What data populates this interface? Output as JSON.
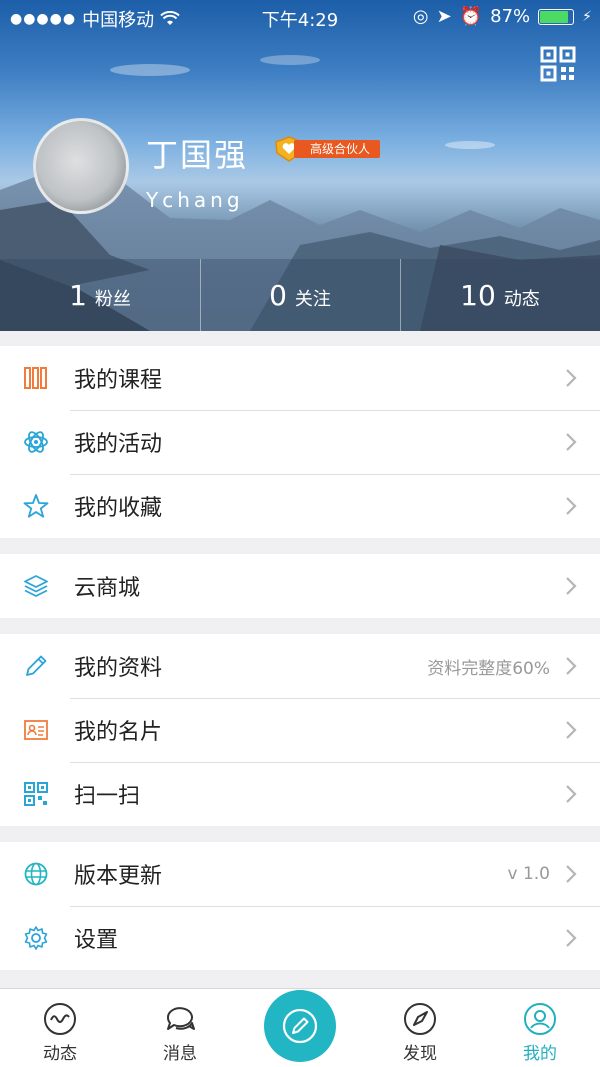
{
  "status_bar": {
    "carrier": "中国移动",
    "time": "下午4:29",
    "battery": "87%",
    "battery_level": 0.87
  },
  "profile": {
    "name": "丁国强",
    "username": "Ychang",
    "badge": "高级合伙人",
    "stats": [
      {
        "value": "1",
        "label": "粉丝"
      },
      {
        "value": "0",
        "label": "关注"
      },
      {
        "value": "10",
        "label": "动态"
      }
    ]
  },
  "menu": {
    "groups": [
      [
        {
          "id": "courses",
          "label": "我的课程",
          "icon": "books-icon"
        },
        {
          "id": "activities",
          "label": "我的活动",
          "icon": "atom-icon"
        },
        {
          "id": "favorites",
          "label": "我的收藏",
          "icon": "star-icon"
        }
      ],
      [
        {
          "id": "mall",
          "label": "云商城",
          "icon": "layers-icon"
        }
      ],
      [
        {
          "id": "profile",
          "label": "我的资料",
          "icon": "pencil-icon",
          "value": "资料完整度60%"
        },
        {
          "id": "card",
          "label": "我的名片",
          "icon": "id-card-icon"
        },
        {
          "id": "scan",
          "label": "扫一扫",
          "icon": "qr-scan-icon"
        }
      ],
      [
        {
          "id": "update",
          "label": "版本更新",
          "icon": "globe-icon",
          "value": "v 1.0"
        },
        {
          "id": "settings",
          "label": "设置",
          "icon": "gear-icon"
        }
      ]
    ]
  },
  "tabbar": {
    "tabs": [
      {
        "label": "动态",
        "icon": "wave-icon"
      },
      {
        "label": "消息",
        "icon": "chat-icon"
      },
      {
        "label": "",
        "icon": "compose-icon"
      },
      {
        "label": "发现",
        "icon": "compass-icon"
      },
      {
        "label": "我的",
        "icon": "user-icon",
        "active": true
      }
    ]
  },
  "colors": {
    "accent": "#22b5c4",
    "orange": "#e8581f",
    "icon_orange": "#f07c3c",
    "icon_blue": "#2aa5d8"
  }
}
